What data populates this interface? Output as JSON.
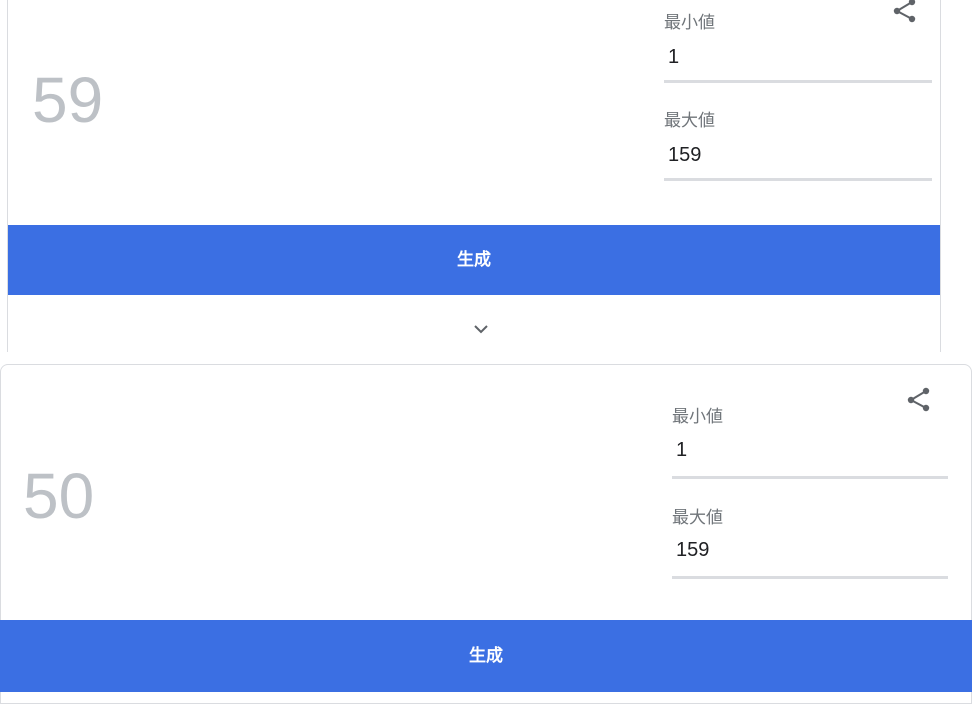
{
  "card_top": {
    "result": "59",
    "min_label": "最小値",
    "min_value": "1",
    "max_label": "最大値",
    "max_value": "159",
    "generate_label": "生成",
    "share_icon": "share-icon",
    "expand_icon": "chevron-down-icon"
  },
  "card_bottom": {
    "result": "50",
    "min_label": "最小値",
    "min_value": "1",
    "max_label": "最大値",
    "max_value": "159",
    "generate_label": "生成",
    "share_icon": "share-icon"
  },
  "colors": {
    "accent": "#3b6fe3",
    "result_text": "#bdc1c6",
    "label_text": "#70757a",
    "underline": "#dadce0"
  }
}
